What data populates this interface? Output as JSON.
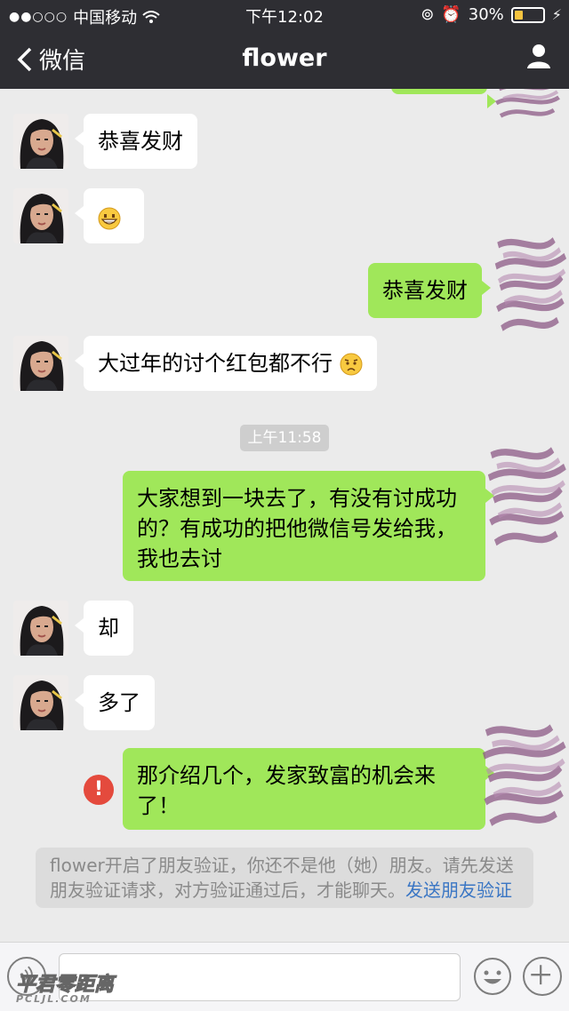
{
  "status_bar": {
    "carrier": "中国移动",
    "time": "下午12:02",
    "battery": "30%",
    "battery_level": 0.3
  },
  "nav": {
    "back_label": "微信",
    "title": "flower"
  },
  "messages": [
    {
      "from": "them",
      "text": "恭喜发财"
    },
    {
      "from": "them",
      "emoji": "grinning-face"
    },
    {
      "from": "me",
      "text": "恭喜发财"
    },
    {
      "from": "them",
      "text": "大过年的讨个红包都不行",
      "emoji": "sad-face"
    },
    {
      "from": "me",
      "text": "大家想到一块去了，有没有讨成功的？有成功的把他微信号发给我，我也去讨"
    },
    {
      "from": "them",
      "text": "却"
    },
    {
      "from": "them",
      "text": "多了"
    },
    {
      "from": "me",
      "text": "那介绍几个，发家致富的机会来了！",
      "failed": true
    }
  ],
  "timestamp": "上午11:58",
  "notice": {
    "text": "flower开启了朋友验证，你还不是他（她）朋友。请先发送朋友验证请求，对方验证通过后，才能聊天。",
    "link": "发送朋友验证"
  },
  "input": {
    "value": "",
    "placeholder": ""
  },
  "watermark": {
    "main": "平君零距离",
    "sub": "PCLJL.COM"
  },
  "colors": {
    "header": "#2e2e33",
    "bubble_out": "#a0e75a",
    "bubble_in": "#ffffff",
    "link": "#3a76c4",
    "error": "#e44a3d"
  }
}
